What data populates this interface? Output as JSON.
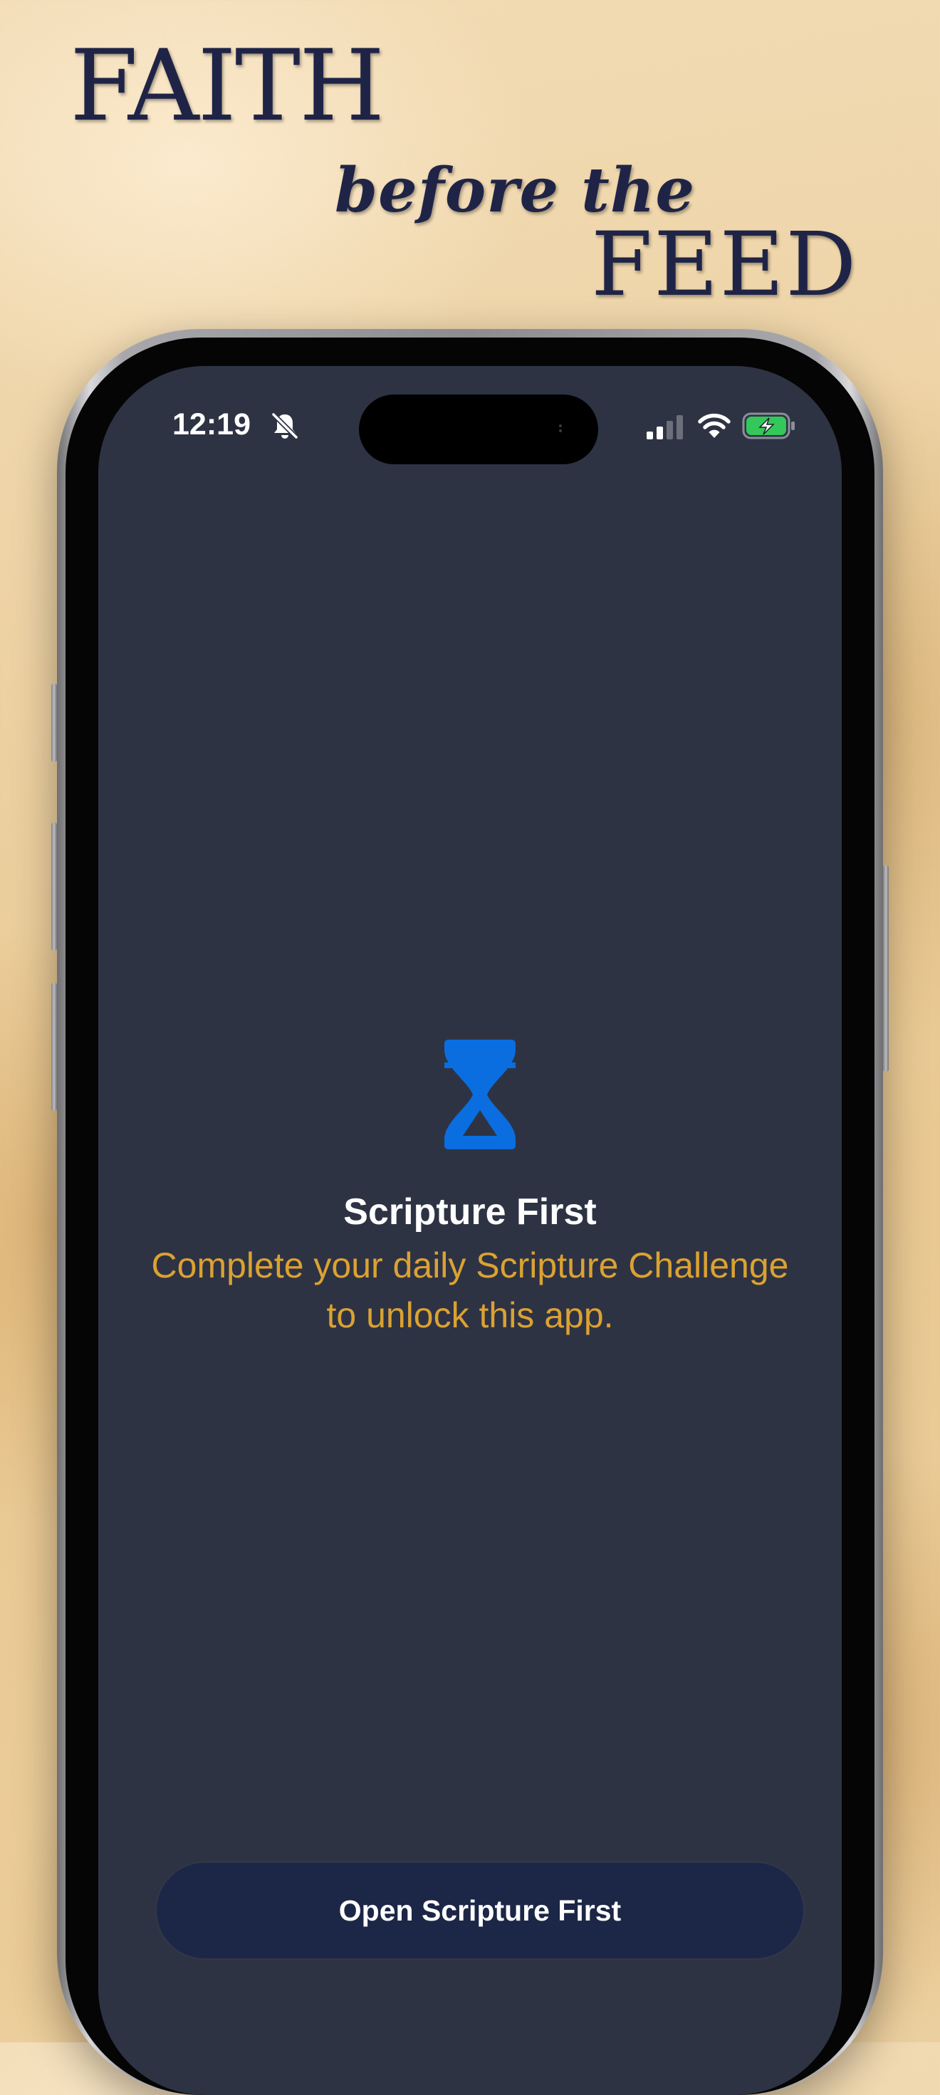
{
  "headline": {
    "line1": "FAITH",
    "line2": "before the",
    "line3": "FEED"
  },
  "status_bar": {
    "time": "12:19",
    "icons": [
      "bell-slash-icon",
      "cellular-signal-icon",
      "wifi-icon",
      "battery-charging-icon"
    ]
  },
  "shield": {
    "icon": "hourglass-icon",
    "title": "Scripture First",
    "subtitle": "Complete your daily Scripture Challenge to unlock this app.",
    "button_label": "Open Scripture First"
  },
  "colors": {
    "headline": "#1f2447",
    "screen_background": "#2e3344",
    "icon_accent": "#0a6ee0",
    "subtitle": "#dba232",
    "button_background": "#1c2646",
    "battery_green": "#34c759"
  }
}
